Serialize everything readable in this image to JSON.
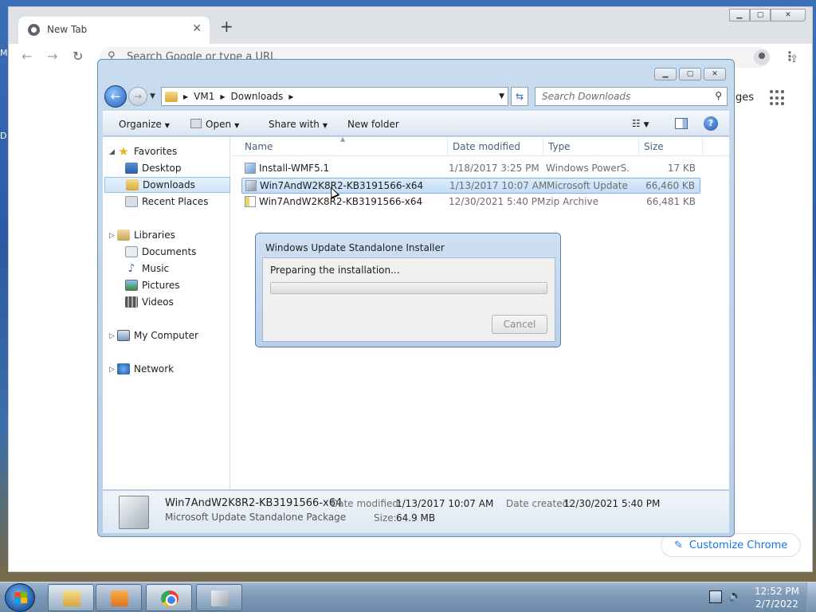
{
  "desktop": {
    "frag_top": "M",
    "frag_mid": "D"
  },
  "chrome": {
    "tab_title": "New Tab",
    "close_glyph": "✕",
    "new_tab_glyph": "+",
    "omnibox_placeholder": "Search Google or type a URL",
    "images_link": "ges",
    "customize_label": "Customize Chrome"
  },
  "explorer": {
    "breadcrumbs": [
      "VM1",
      "Downloads"
    ],
    "search_placeholder": "Search Downloads",
    "commands": {
      "organize": "Organize",
      "open": "Open",
      "share_with": "Share with",
      "new_folder": "New folder"
    },
    "nav": {
      "favorites": "Favorites",
      "desktop": "Desktop",
      "downloads": "Downloads",
      "recent_places": "Recent Places",
      "libraries": "Libraries",
      "documents": "Documents",
      "music": "Music",
      "pictures": "Pictures",
      "videos": "Videos",
      "my_computer": "My Computer",
      "network": "Network"
    },
    "columns": {
      "name": "Name",
      "date": "Date modified",
      "type": "Type",
      "size": "Size"
    },
    "files": [
      {
        "name": "Install-WMF5.1",
        "date": "1/18/2017 3:25 PM",
        "type": "Windows PowerS...",
        "size": "17 KB",
        "icon": "powershell-script-icon"
      },
      {
        "name": "Win7AndW2K8R2-KB3191566-x64",
        "date": "1/13/2017 10:07 AM",
        "type": "Microsoft Update ...",
        "size": "66,460 KB",
        "icon": "msu-package-icon"
      },
      {
        "name": "Win7AndW2K8R2-KB3191566-x64",
        "date": "12/30/2021 5:40 PM",
        "type": "zip Archive",
        "size": "66,481 KB",
        "icon": "zip-archive-icon"
      }
    ],
    "details": {
      "name": "Win7AndW2K8R2-KB3191566-x64",
      "type": "Microsoft Update Standalone Package",
      "date_modified_label": "Date modified:",
      "date_modified": "1/13/2017 10:07 AM",
      "date_created_label": "Date created:",
      "date_created": "12/30/2021 5:40 PM",
      "size_label": "Size:",
      "size": "64.9 MB"
    }
  },
  "installer": {
    "title": "Windows Update Standalone Installer",
    "message": "Preparing the installation...",
    "progress_fraction": 0,
    "cancel_label": "Cancel"
  },
  "taskbar": {
    "time": "12:52 PM",
    "date": "2/7/2022"
  }
}
